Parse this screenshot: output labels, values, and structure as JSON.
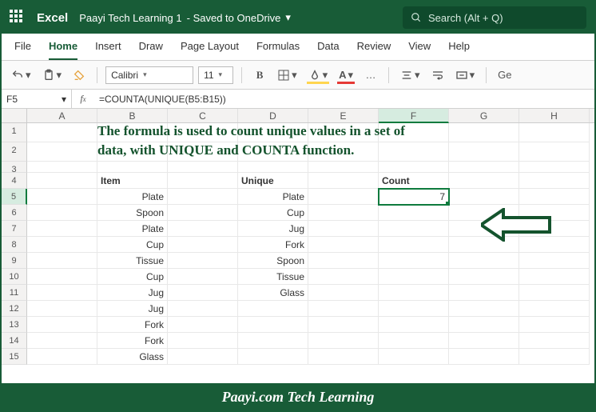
{
  "title": {
    "app": "Excel",
    "doc": "Paayi Tech Learning 1",
    "saved": " - Saved to OneDrive"
  },
  "search": {
    "placeholder": "Search (Alt + Q)"
  },
  "tabs": [
    "File",
    "Home",
    "Insert",
    "Draw",
    "Page Layout",
    "Formulas",
    "Data",
    "Review",
    "View",
    "Help"
  ],
  "active_tab": "Home",
  "toolbar": {
    "font": "Calibri",
    "size": "11",
    "more": "…",
    "ge": "Ge"
  },
  "namebox": "F5",
  "formula": "=COUNTA(UNIQUE(B5:B15))",
  "explain1": "The formula is used to count unique values in a set of",
  "explain2": "data, with UNIQUE and COUNTA function.",
  "headers": {
    "item": "Item",
    "unique": "Unique",
    "count": "Count"
  },
  "items": [
    "Plate",
    "Spoon",
    "Plate",
    "Cup",
    "Tissue",
    "Cup",
    "Jug",
    "Jug",
    "Fork",
    "Fork",
    "Glass"
  ],
  "uniques": [
    "Plate",
    "Cup",
    "Jug",
    "Fork",
    "Spoon",
    "Tissue",
    "Glass"
  ],
  "count": "7",
  "cols": [
    "A",
    "B",
    "C",
    "D",
    "E",
    "F",
    "G",
    "H"
  ],
  "footer": "Paayi.com Tech Learning",
  "icons": {
    "chevdown": "▾",
    "search": "🔍"
  }
}
